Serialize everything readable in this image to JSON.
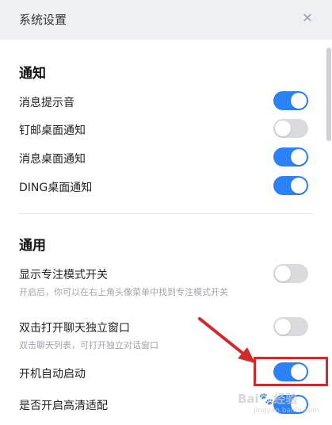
{
  "window": {
    "title": "系统设置",
    "close_icon": "close-icon"
  },
  "sections": {
    "notify": {
      "title": "通知",
      "items": [
        {
          "label": "消息提示音",
          "on": true
        },
        {
          "label": "钉邮桌面通知",
          "on": false
        },
        {
          "label": "消息桌面通知",
          "on": true
        },
        {
          "label": "DING桌面通知",
          "on": true
        }
      ]
    },
    "general": {
      "title": "通用",
      "items": [
        {
          "label": "显示专注模式开关",
          "desc": "开启后，你可以在右上角头像菜单中找到专注模式开关",
          "on": false
        },
        {
          "label": "双击打开聊天独立窗口",
          "desc": "双击聊天列表，可打开独立对话窗口",
          "on": false
        },
        {
          "label": "开机自动启动",
          "on": true
        },
        {
          "label": "是否开启高清适配",
          "on": true
        }
      ]
    }
  },
  "colors": {
    "toggle_on": "#2b82f6",
    "toggle_off": "#d9dbdf",
    "annotation": "#d22a2a"
  },
  "watermark": {
    "brand": "Bai",
    "brand_suffix": "经验",
    "domain": "jingyan.baidu.com"
  }
}
